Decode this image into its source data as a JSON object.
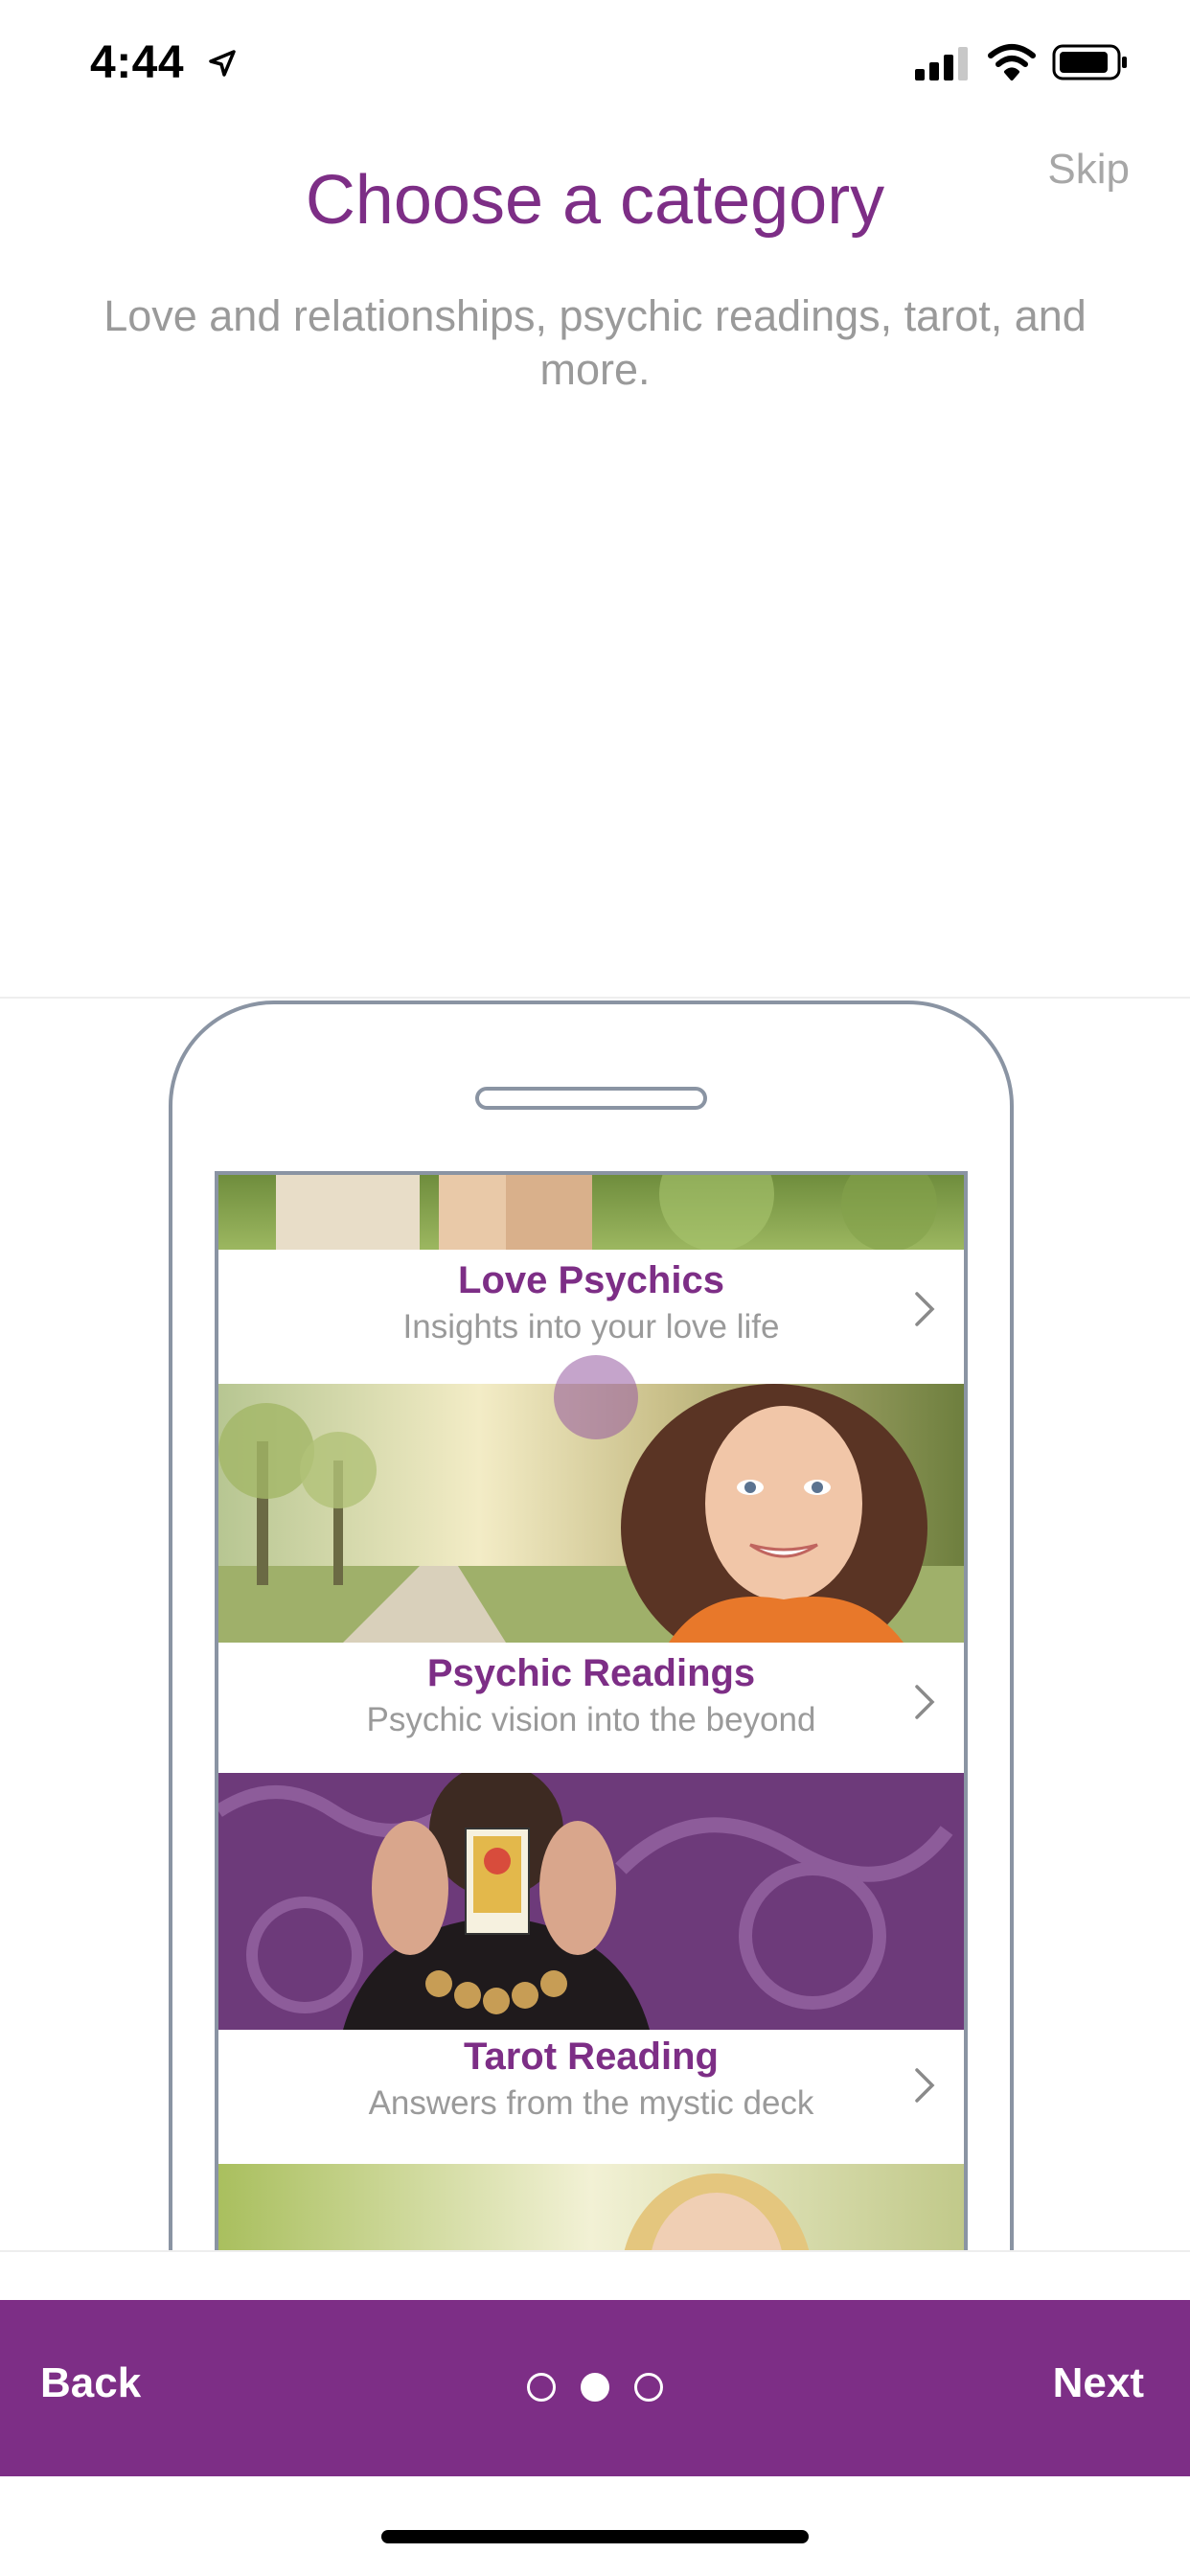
{
  "status": {
    "time": "4:44"
  },
  "header": {
    "skip_label": "Skip",
    "title": "Choose a category",
    "subtitle": "Love and relationships, psychic readings, tarot, and more."
  },
  "categories": [
    {
      "title": "Love Psychics",
      "subtitle": "Insights into your love life"
    },
    {
      "title": "Psychic Readings",
      "subtitle": "Psychic vision into the beyond"
    },
    {
      "title": "Tarot Reading",
      "subtitle": "Answers from the mystic deck"
    }
  ],
  "footer": {
    "back_label": "Back",
    "next_label": "Next",
    "page_count": 3,
    "active_page": 2
  },
  "colors": {
    "accent": "#7d2e86",
    "muted_text": "#9a9a9a",
    "skip": "#a7a7a7"
  }
}
